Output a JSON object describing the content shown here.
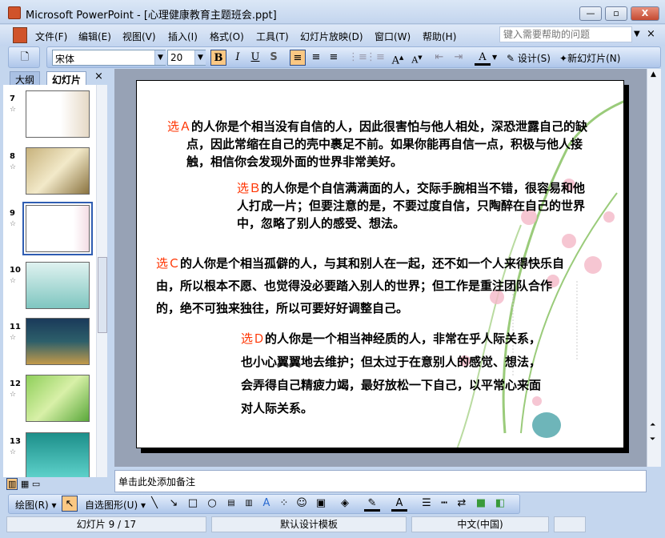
{
  "window": {
    "title": "Microsoft PowerPoint - [心理健康教育主题班会.ppt]",
    "minimize": "—",
    "restore": "▫",
    "close": "X"
  },
  "menu": [
    "文件(F)",
    "编辑(E)",
    "视图(V)",
    "插入(I)",
    "格式(O)",
    "工具(T)",
    "幻灯片放映(D)",
    "窗口(W)",
    "帮助(H)"
  ],
  "help": {
    "placeholder": "键入需要帮助的问题",
    "close": "×"
  },
  "formatting": {
    "font": "宋体",
    "size": "20",
    "bold": "B",
    "italic": "I",
    "underline": "U",
    "shadow": "S",
    "design": "设计(S)",
    "new_slide": "新幻灯片(N)"
  },
  "panel": {
    "tabs": [
      "大纲",
      "幻灯片"
    ],
    "close": "×"
  },
  "thumbnails": [
    {
      "num": "7"
    },
    {
      "num": "8"
    },
    {
      "num": "9",
      "selected": true
    },
    {
      "num": "10"
    },
    {
      "num": "11"
    },
    {
      "num": "12"
    },
    {
      "num": "13"
    }
  ],
  "slide": {
    "a": {
      "label": "选Ａ",
      "text": "的人你是个相当没有自信的人，因此很害怕与他人相处，深恐泄露自己的缺点，因此常缩在自己的壳中裹足不前。如果你能再自信一点，积极与他人接触，相信你会发现外面的世界非常美好。"
    },
    "b": {
      "label": "选Ｂ",
      "text": "的人你是个自信满满面的人，交际手腕相当不错，很容易和他人打成一片；但要注意的是，不要过度自信，只陶醉在自己的世界中，忽略了别人的感受、想法。"
    },
    "c": {
      "label": "选Ｃ",
      "text": "的人你是个相当孤僻的人，与其和别人在一起，还不如一个人来得快乐自由，所以根本不愿、也觉得没必要踏入别人的世界；但工作是重注团队合作的，绝不可独来独往，所以可要好好调整自己。"
    },
    "d": {
      "label": "选Ｄ",
      "text": "的人你是一个相当神经质的人，非常在乎人际关系，也小心翼翼地去维护；但太过于在意别人的感觉、想法，会弄得自己精疲力竭，最好放松一下自己，以平常心来面对人际关系。"
    }
  },
  "notes": {
    "placeholder": "单击此处添加备注"
  },
  "drawing": {
    "draw": "绘图(R)",
    "autoshapes": "自选图形(U)"
  },
  "status": {
    "slide": "幻灯片 9 / 17",
    "template": "默认设计模板",
    "language": "中文(中国)"
  }
}
